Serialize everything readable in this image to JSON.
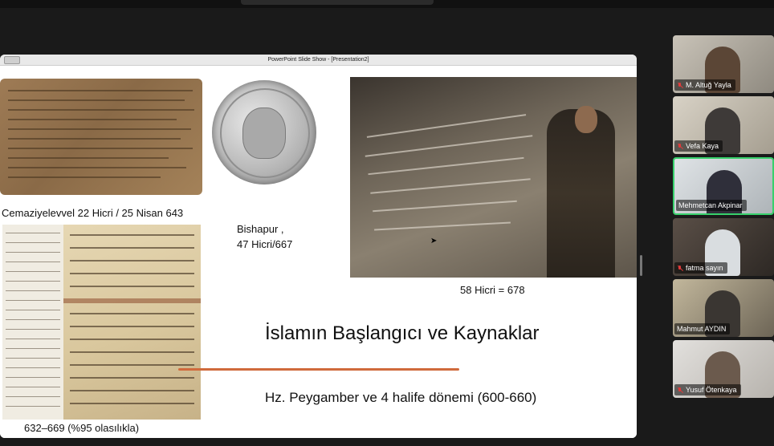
{
  "window": {
    "slideshow_title": "PowerPoint Slide Show - [Presentation2]"
  },
  "slide": {
    "caption_papyrus": "Cemaziyelevvel 22 Hicri / 25 Nisan 643",
    "caption_bishapur_line1": "Bishapur ,",
    "caption_bishapur_line2": "47 Hicri/667",
    "caption_rock": "58 Hicri = 678",
    "caption_manuscript": "632–669 (%95 olasılıkla)",
    "title": "İslamın Başlangıcı ve Kaynaklar",
    "subtitle": "Hz. Peygamber ve 4 halife dönemi (600-660)",
    "accent_line_color": "#d06a3c"
  },
  "participants": [
    {
      "name": "M. Altuğ Yayla",
      "muted": true,
      "active": false
    },
    {
      "name": "Vefa Kaya",
      "muted": true,
      "active": false
    },
    {
      "name": "Mehmetcan Akpinar",
      "muted": false,
      "active": true
    },
    {
      "name": "fatma sayın",
      "muted": true,
      "active": false
    },
    {
      "name": "Mahmut AYDIN",
      "muted": false,
      "active": false
    },
    {
      "name": "Yusuf Ötenkaya",
      "muted": true,
      "active": false
    }
  ],
  "colors": {
    "active_speaker_border": "#37d06b",
    "muted_icon": "#e23b3b"
  }
}
